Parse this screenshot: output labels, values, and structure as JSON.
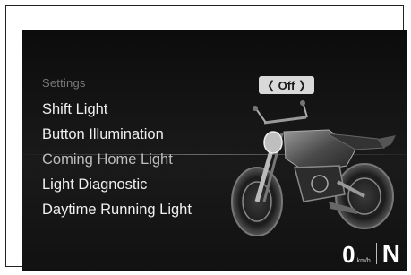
{
  "menu": {
    "header": "Settings",
    "items": [
      {
        "label": "Shift Light"
      },
      {
        "label": "Button Illumination"
      },
      {
        "label": "Coming Home Light"
      },
      {
        "label": "Light Diagnostic"
      },
      {
        "label": "Daytime Running Light"
      }
    ],
    "selected_index": 2
  },
  "setting_value": {
    "left_chevron": "❬",
    "value": "Off",
    "right_chevron": "❭"
  },
  "status": {
    "speed": "0",
    "unit": "km/h",
    "gear": "N"
  },
  "colors": {
    "background": "#111111",
    "text": "#f0f0f0",
    "header_text": "#7a7a7a",
    "toggle_bg": "#d9d9d9"
  }
}
